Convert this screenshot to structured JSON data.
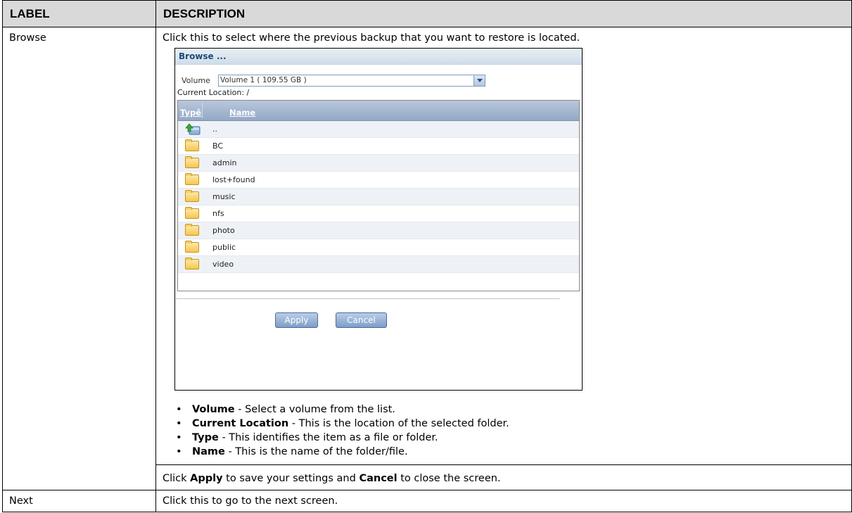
{
  "table": {
    "header": {
      "label": "LABEL",
      "description": "DESCRIPTION"
    },
    "rows": [
      {
        "label": "Browse",
        "description": "Click this to select where the previous backup that you want to restore is located.",
        "dialog": {
          "title": "Browse ...",
          "volume_label": "Volume",
          "volume_value": "Volume 1 ( 109.55 GB )",
          "current_location": "Current Location: /",
          "columns": {
            "type": "Typê",
            "name": "Name"
          },
          "items": [
            {
              "name": "..",
              "icon": "folder-up-icon"
            },
            {
              "name": "BC",
              "icon": "folder-icon"
            },
            {
              "name": "admin",
              "icon": "folder-icon"
            },
            {
              "name": "lost+found",
              "icon": "folder-icon"
            },
            {
              "name": "music",
              "icon": "folder-icon"
            },
            {
              "name": "nfs",
              "icon": "folder-icon"
            },
            {
              "name": "photo",
              "icon": "folder-icon"
            },
            {
              "name": "public",
              "icon": "folder-icon"
            },
            {
              "name": "video",
              "icon": "folder-icon"
            }
          ],
          "apply_label": "Apply",
          "cancel_label": "Cancel"
        },
        "bullets": [
          {
            "term": "Volume",
            "text": " - Select a volume from the list."
          },
          {
            "term": "Current Location",
            "text": " - This is the location of the selected folder."
          },
          {
            "term": "Type",
            "text": " - This identifies the item as a file or folder."
          },
          {
            "term": "Name",
            "text": " - This is the name of the folder/file."
          }
        ],
        "final": {
          "pre": "Click ",
          "apply": "Apply",
          "mid": " to save your settings and ",
          "cancel": "Cancel",
          "post": " to close the screen."
        }
      },
      {
        "label": "Next",
        "description": "Click this to go to the next screen."
      }
    ]
  }
}
